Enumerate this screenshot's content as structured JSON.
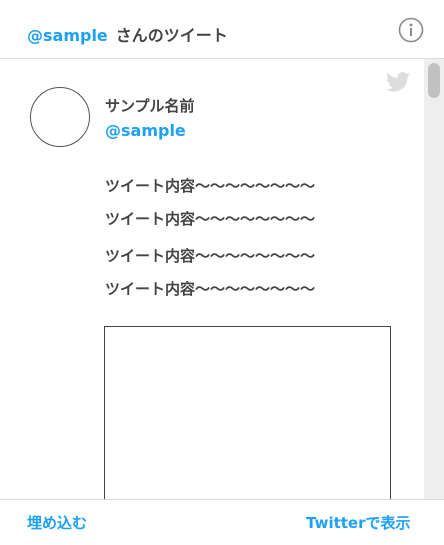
{
  "header": {
    "handle": "@sample",
    "title_suffix": "さんのツイート",
    "info_icon": "info-icon"
  },
  "tweet": {
    "bird_icon": "twitter-bird-icon",
    "author_name": "サンプル名前",
    "author_handle": "@sample",
    "lines": [
      "ツイート内容〜〜〜〜〜〜〜〜",
      "ツイート内容〜〜〜〜〜〜〜〜",
      "ツイート内容〜〜〜〜〜〜〜〜",
      "ツイート内容〜〜〜〜〜〜〜〜"
    ]
  },
  "footer": {
    "embed_label": "埋め込む",
    "view_on_twitter_label": "Twitterで表示"
  },
  "colors": {
    "accent": "#1da1f2",
    "text": "#444444",
    "border": "#dcdcdc"
  }
}
